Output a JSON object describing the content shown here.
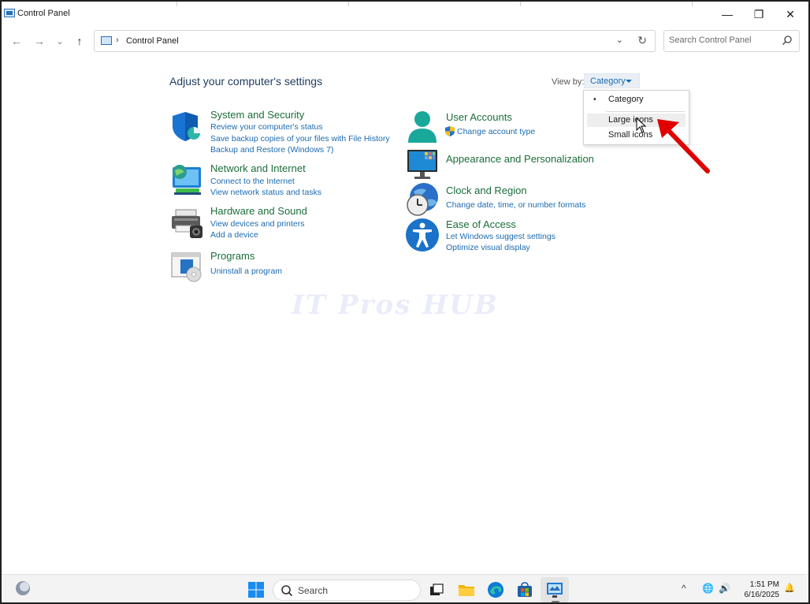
{
  "window": {
    "title": "Control Panel",
    "controls": {
      "minimize": "—",
      "maximize": "❐",
      "close": "✕"
    }
  },
  "nav": {
    "back": "←",
    "forward": "→",
    "recent": "⌄",
    "up": "↑",
    "breadcrumb_sep": "›",
    "breadcrumb": "Control Panel",
    "dropdown": "⌄",
    "refresh": "↻"
  },
  "search": {
    "placeholder": "Search Control Panel"
  },
  "main": {
    "heading": "Adjust your computer's settings",
    "view_by_label": "View by:",
    "view_by_value": "Category",
    "view_menu": {
      "selected_marker": "•",
      "items": [
        "Category",
        "Large icons",
        "Small icons"
      ]
    },
    "categories": [
      {
        "title": "System and Security",
        "icon": "shield-icon",
        "links": [
          "Review your computer's status",
          "Save backup copies of your files with File History",
          "Backup and Restore (Windows 7)"
        ]
      },
      {
        "title": "Network and Internet",
        "icon": "network-globe-icon",
        "links": [
          "Connect to the Internet",
          "View network status and tasks"
        ]
      },
      {
        "title": "Hardware and Sound",
        "icon": "printer-icon",
        "links": [
          "View devices and printers",
          "Add a device"
        ]
      },
      {
        "title": "Programs",
        "icon": "programs-disc-icon",
        "links": [
          "Uninstall a program"
        ]
      },
      {
        "title": "User Accounts",
        "icon": "user-accounts-icon",
        "links": [
          "Change account type"
        ]
      },
      {
        "title": "Appearance and Personalization",
        "icon": "monitor-icon",
        "links": []
      },
      {
        "title": "Clock and Region",
        "icon": "clock-globe-icon",
        "links": [
          "Change date, time, or number formats"
        ]
      },
      {
        "title": "Ease of Access",
        "icon": "accessibility-icon",
        "links": [
          "Let Windows suggest settings",
          "Optimize visual display"
        ]
      }
    ]
  },
  "watermark": "IT Pros HUB",
  "taskbar": {
    "search_text": "Search",
    "time": "1:51 PM",
    "date": "6/16/2025",
    "tray": {
      "chevron": "^",
      "network": "🌐",
      "volume": "🔊",
      "bell": "🔔"
    }
  },
  "colors": {
    "link": "#1c6bb0",
    "category_title": "#1b6e3a",
    "heading": "#1e3a5f",
    "annotation_arrow": "#e00000"
  }
}
